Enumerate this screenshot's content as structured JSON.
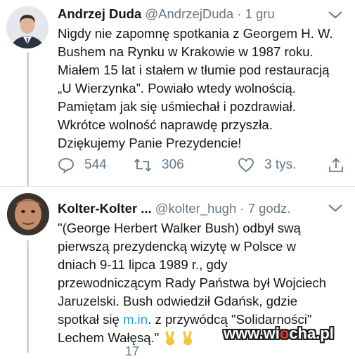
{
  "tweets": [
    {
      "display_name": "Andrzej Duda",
      "handle": "@AndrzejDuda",
      "separator": "·",
      "time": "1 gru",
      "lines": [
        "Nigdy nie zapomnę spotkania z Georgem H. W.",
        "Bushem na Rynku w Krakowie w 1987 roku.",
        "Miałem 15 lat i stałem w tłumie pod restauracją",
        "„U Wierzynka”. Powiało wtedy wolnością.",
        "Pamiętam jak się uśmiechał i pozdrawiał.",
        "Wkrótce wolność naprawdę przyszła.",
        "Dziękujemy Panie Prezydencie!"
      ],
      "replies": "544",
      "retweets": "306",
      "likes": "3 tys."
    },
    {
      "display_name": "Kolter-Kolter ...",
      "handle": "@kolter_hugh",
      "separator": "·",
      "time": "7 godz.",
      "lines": [
        "\"(George Herbert Walker Bush) odbył swą",
        "pierwszą prezydencką wizytę w Polsce w",
        "dniach 9-11 lipca 1989 r., gdy",
        "przewodniczącym Rady Państwa był Wojciech",
        "Jaruzelski. Bush odwiedził Gdańsk, gdzie"
      ],
      "line6_before": "spotkał się ",
      "line6_link": "m.in",
      "line6_after": ". z przywódcą \"Solidarności\"",
      "line7": "Lechem Wałęsą.\"",
      "partial_count": "17"
    }
  ],
  "watermark": {
    "part1": "www.wi",
    "part2": "o",
    "part3": "cha.pl"
  },
  "colors": {
    "link": "#1da1f2",
    "meta": "#657786",
    "divider": "#e1e8ed"
  },
  "icons": [
    "reply-icon",
    "retweet-icon",
    "like-icon",
    "share-icon",
    "chevron-down-icon",
    "victory-hand-emoji"
  ]
}
